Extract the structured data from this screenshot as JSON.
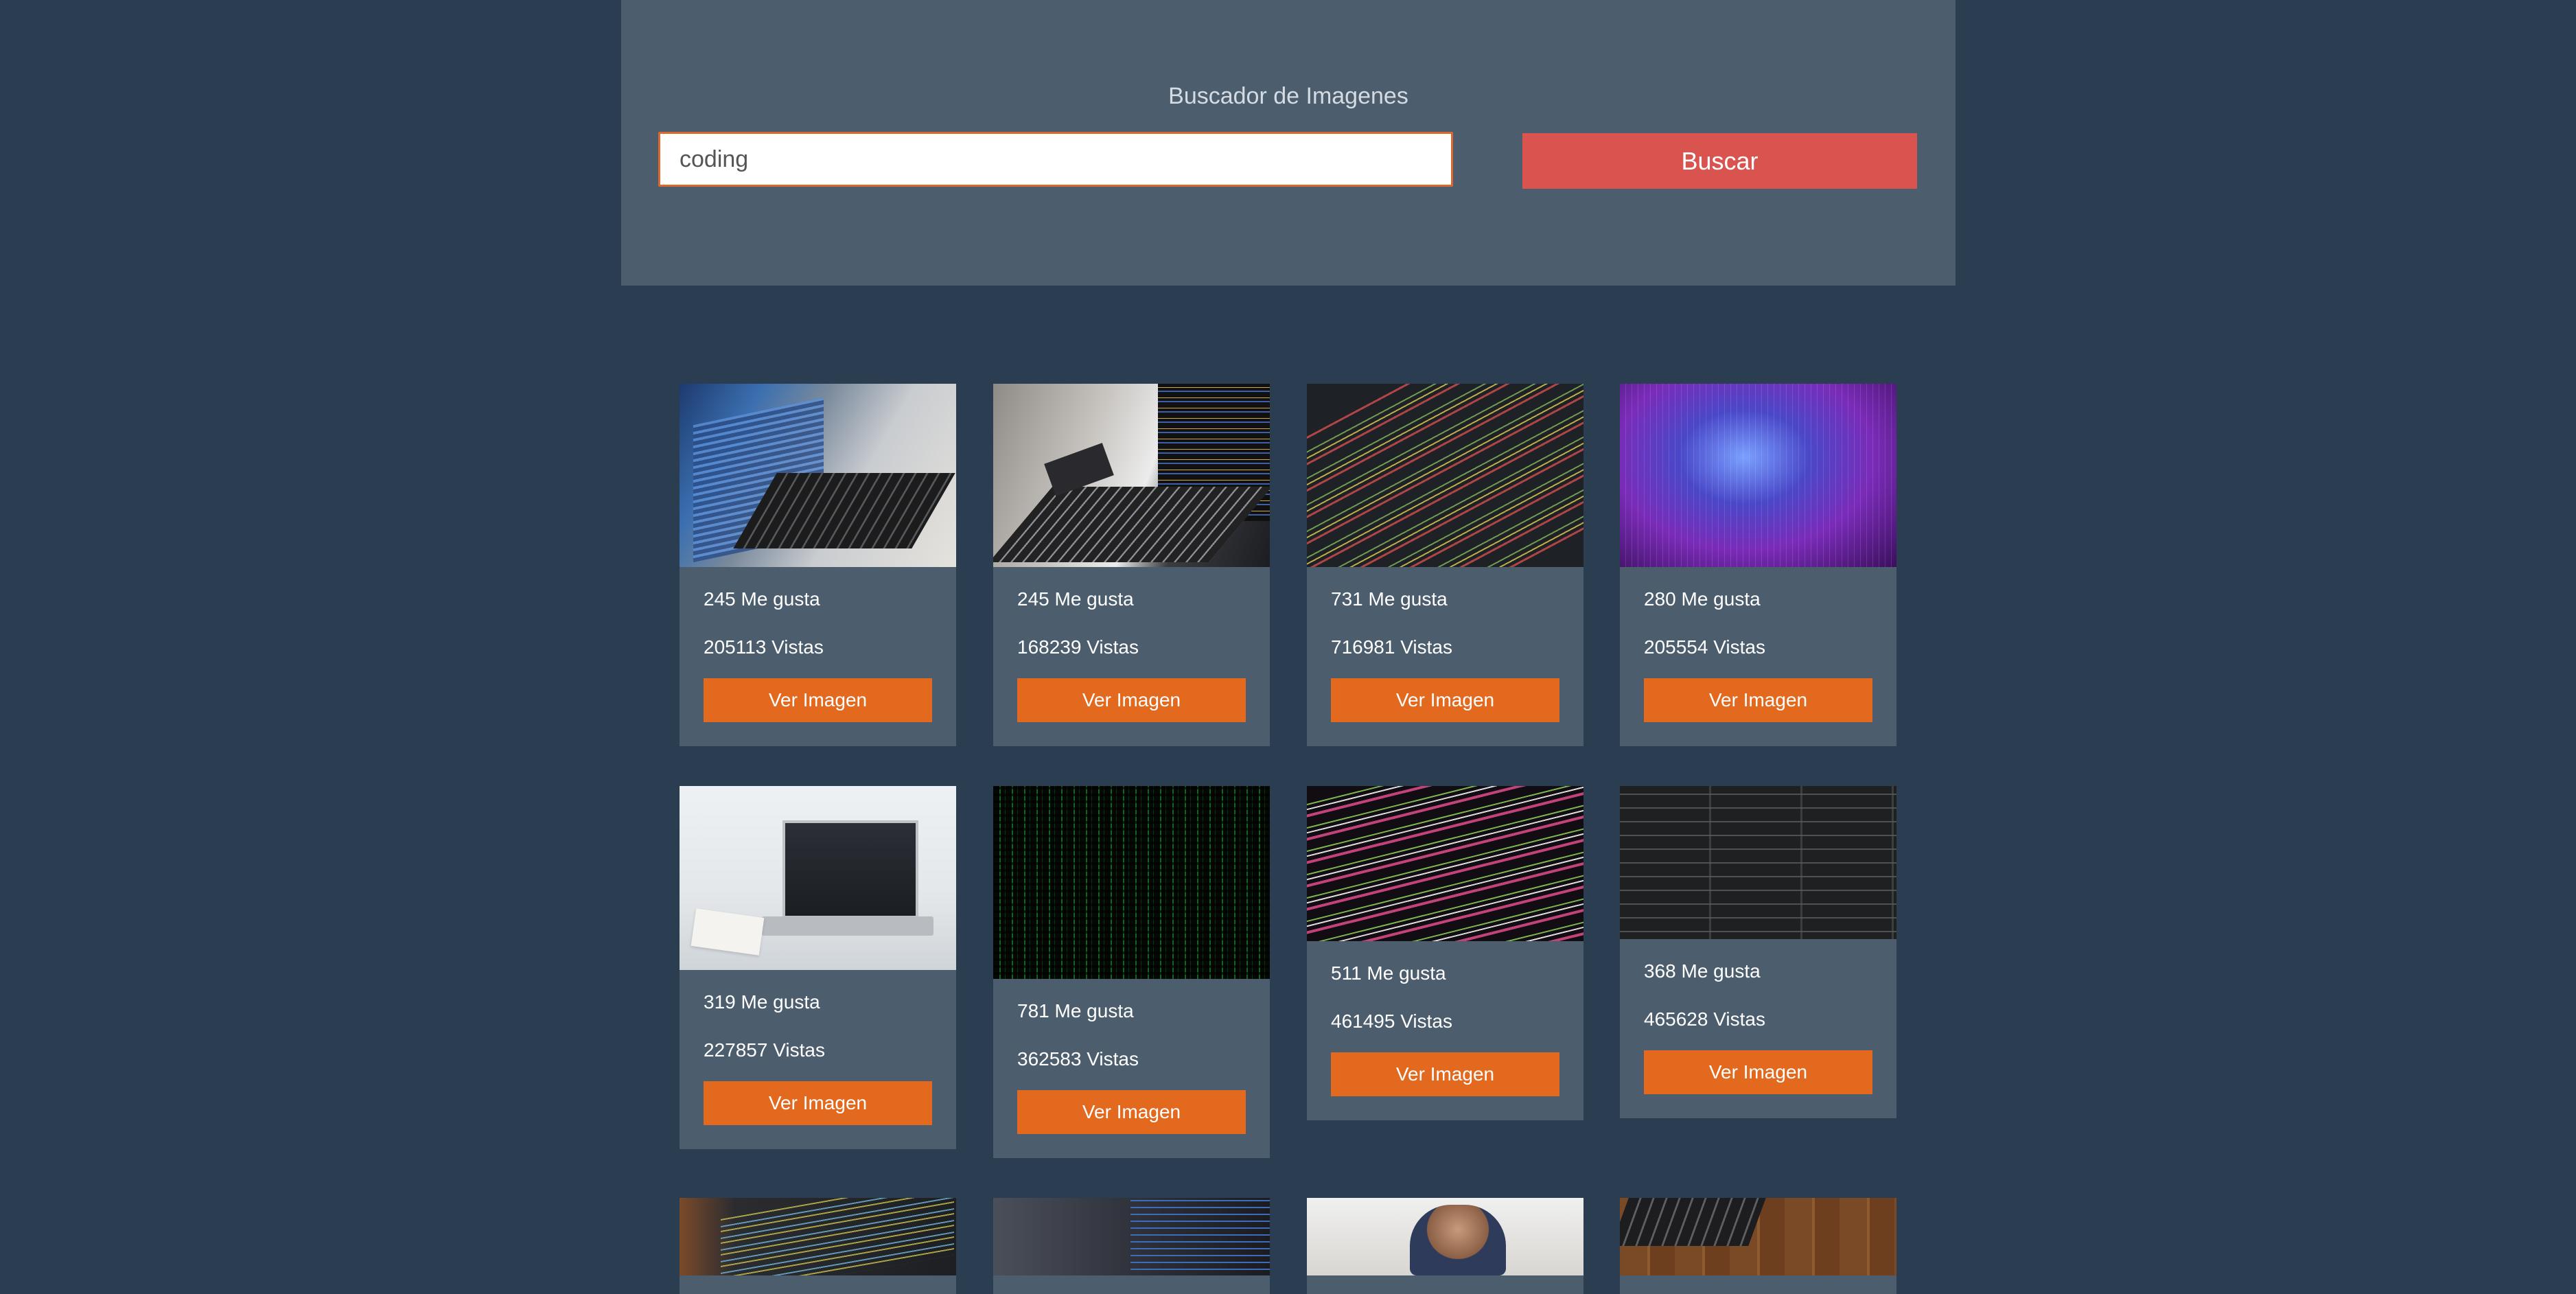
{
  "header": {
    "title": "Buscador de Imagenes",
    "search_value": "coding",
    "search_button": "Buscar"
  },
  "cards": [
    {
      "likes": "245 Me gusta",
      "views": "205113 Vistas",
      "button": "Ver Imagen"
    },
    {
      "likes": "245 Me gusta",
      "views": "168239 Vistas",
      "button": "Ver Imagen"
    },
    {
      "likes": "731 Me gusta",
      "views": "716981 Vistas",
      "button": "Ver Imagen"
    },
    {
      "likes": "280 Me gusta",
      "views": "205554 Vistas",
      "button": "Ver Imagen"
    },
    {
      "likes": "319 Me gusta",
      "views": "227857 Vistas",
      "button": "Ver Imagen"
    },
    {
      "likes": "781 Me gusta",
      "views": "362583 Vistas",
      "button": "Ver Imagen"
    },
    {
      "likes": "511 Me gusta",
      "views": "461495 Vistas",
      "button": "Ver Imagen"
    },
    {
      "likes": "368 Me gusta",
      "views": "465628 Vistas",
      "button": "Ver Imagen"
    }
  ]
}
